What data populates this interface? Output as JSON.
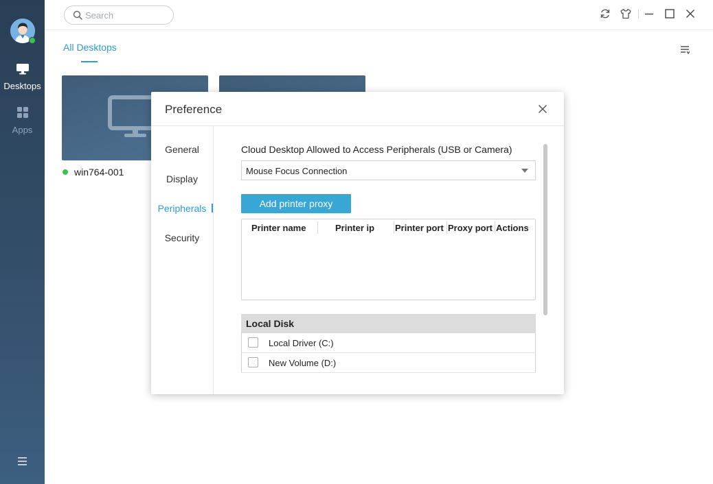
{
  "sidebar": {
    "nav": [
      {
        "label": "Desktops",
        "icon": "monitor-icon",
        "active": true
      },
      {
        "label": "Apps",
        "icon": "apps-grid-icon",
        "active": false
      }
    ],
    "menu_icon": "hamburger-menu-icon",
    "avatar_status_color": "#3ec152"
  },
  "topbar": {
    "search_placeholder": "Search",
    "buttons": [
      "refresh-icon",
      "skin-icon",
      "minimize-icon",
      "maximize-icon",
      "close-icon"
    ]
  },
  "main": {
    "tab_label": "All Desktops",
    "accent_color": "#2f9bd0",
    "desktops": [
      {
        "name": "win764-001",
        "status_color": "#3ec152"
      }
    ]
  },
  "dialog": {
    "title": "Preference",
    "nav": [
      "General",
      "Display",
      "Peripherals",
      "Security"
    ],
    "active_nav": "Peripherals",
    "peripherals": {
      "access_label": "Cloud Desktop Allowed to Access Peripherals (USB or Camera)",
      "access_value": "Mouse Focus Connection",
      "add_printer_label": "Add printer proxy",
      "printer_columns": [
        "Printer name",
        "Printer ip",
        "Printer port",
        "Proxy port",
        "Actions"
      ],
      "local_disk_title": "Local Disk",
      "local_disks": [
        "Local Driver (C:)",
        "New Volume (D:)"
      ]
    }
  }
}
